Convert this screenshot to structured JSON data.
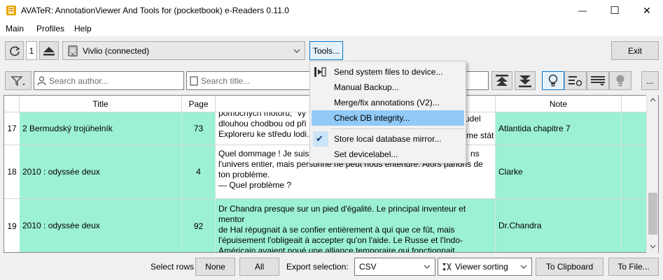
{
  "window": {
    "title": "AVATeR: AnnotationViewer And Tools for (pocketbook) e-Readers 0.11.0",
    "minimize_glyph": "—",
    "maximize_glyph": "☐",
    "close_glyph": "✕"
  },
  "menubar": {
    "items": [
      "Main",
      "Profiles",
      "Help"
    ]
  },
  "toolbar": {
    "refresh_icon": "refresh-icon",
    "count": "1",
    "eject_icon": "eject-icon",
    "device": "Vivlio  (connected)",
    "tools_label": "Tools...",
    "exit_label": "Exit"
  },
  "filterbar": {
    "search_author_placeholder": "Search author...",
    "search_title_placeholder": "Search title...",
    "more_label": "..."
  },
  "grid": {
    "columns": [
      "Title",
      "Page",
      "",
      "Note"
    ],
    "rows": [
      {
        "num": "17",
        "title": "2 Bermudský trojúhelník",
        "page": "73",
        "text": "pomocných motorů, \"vy... dlouhou chodbou od při... Exploreru ke středu lodi.",
        "note": "Atlantida chapitre 7"
      },
      {
        "num": "18",
        "title": "2010 : odyssée deux",
        "page": "4",
        "text": "Quel dommage ! Je suis c... l'univers entier, mais personne ne peut nous entendre. Alors parlons de ton problème. — Quel problème ?",
        "note": "Clarke"
      },
      {
        "num": "19",
        "title": "2010 : odyssée deux",
        "page": "92",
        "text": "Dr Chandra presque sur un pied d'égalité. Le principal inventeur et mentor de Hal répugnait à se confier entièrement à qui que ce fût, mais l'épuisement l'obligeait à accepter qu'on l'aide. Le Russe et l'Indo-Américain avaient noué une alliance temporaire qui fonctionnait",
        "note": "Dr.Chandra"
      }
    ],
    "row17_lines": [
      "pomocných motorů, \"vy",
      "dlouhou chodbou od při",
      "Exploreru ke středu lodi."
    ],
    "row17_tail": [
      "udel",
      "me stát"
    ],
    "row18_lines": [
      "Quel dommage ! Je suis c",
      "l'univers entier, mais personne ne peut nous entendre. Alors parlons de",
      "ton problème.",
      "— Quel problème ?"
    ],
    "row18_tail": "ns",
    "row19_lines": [
      "Dr Chandra presque sur un pied d'égalité. Le principal inventeur et mentor",
      "de Hal répugnait à se confier entièrement à qui que ce fût, mais",
      "l'épuisement l'obligeait à accepter qu'on l'aide. Le Russe et l'Indo-",
      "Américain avaient noué une alliance temporaire qui fonctionnait"
    ]
  },
  "tools_menu": {
    "items": [
      "Send system files to device...",
      "Manual Backup...",
      "Merge/fix annotations (V2)...",
      "Check DB integrity...",
      "Store local database mirror...",
      "Set devicelabel..."
    ],
    "checked_glyph": "✔"
  },
  "bottombar": {
    "select_rows_label": "Select rows",
    "none_label": "None",
    "all_label": "All",
    "export_selection_label": "Export selection:",
    "format": "CSV",
    "sorting": "Viewer sorting",
    "clipboard_label": "To Clipboard",
    "file_label": "To File..."
  },
  "colors": {
    "highlight": "#9cf1d2",
    "menu_selected": "#91c9f7",
    "accent": "#0078d7"
  }
}
